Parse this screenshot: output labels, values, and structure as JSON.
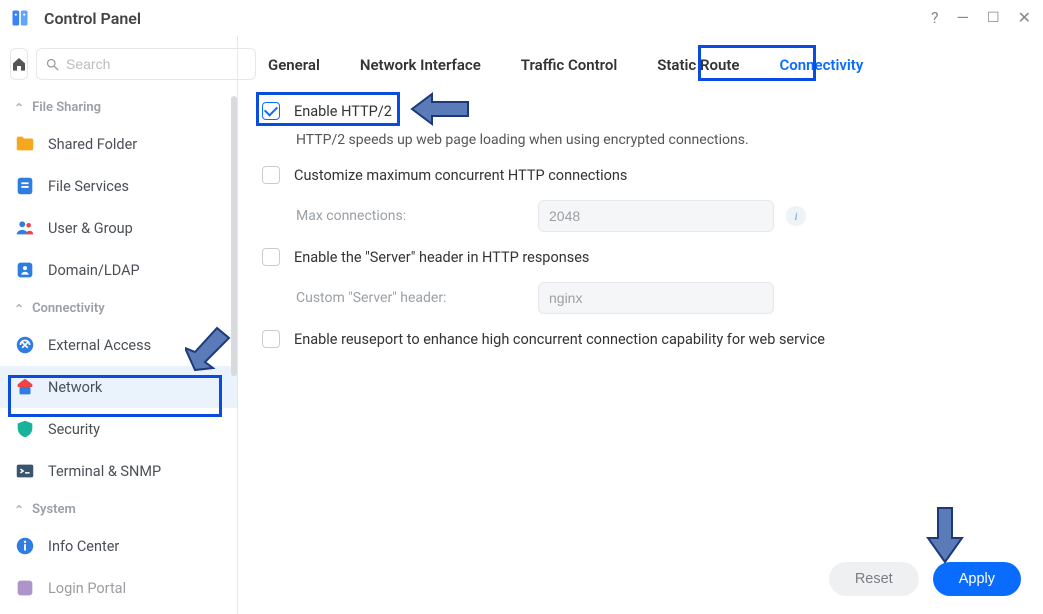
{
  "titlebar": {
    "title": "Control Panel"
  },
  "search": {
    "placeholder": "Search"
  },
  "sidebar": {
    "sections": [
      {
        "label": "File Sharing",
        "items": [
          {
            "label": "Shared Folder"
          },
          {
            "label": "File Services"
          },
          {
            "label": "User & Group"
          },
          {
            "label": "Domain/LDAP"
          }
        ]
      },
      {
        "label": "Connectivity",
        "items": [
          {
            "label": "External Access"
          },
          {
            "label": "Network"
          },
          {
            "label": "Security"
          },
          {
            "label": "Terminal & SNMP"
          }
        ]
      },
      {
        "label": "System",
        "items": [
          {
            "label": "Info Center"
          },
          {
            "label": "Login Portal"
          }
        ]
      }
    ]
  },
  "tabs": {
    "items": [
      "General",
      "Network Interface",
      "Traffic Control",
      "Static Route",
      "Connectivity"
    ],
    "active": 4
  },
  "panel": {
    "http2_label": "Enable HTTP/2",
    "http2_desc": "HTTP/2 speeds up web page loading when using encrypted connections.",
    "customize_label": "Customize maximum concurrent HTTP connections",
    "max_conn_label": "Max connections:",
    "max_conn_value": "2048",
    "server_header_label": "Enable the \"Server\" header in HTTP responses",
    "custom_header_label": "Custom \"Server\" header:",
    "custom_header_value": "nginx",
    "reuseport_label": "Enable reuseport to enhance high concurrent connection capability for web service"
  },
  "footer": {
    "reset_label": "Reset",
    "apply_label": "Apply"
  }
}
